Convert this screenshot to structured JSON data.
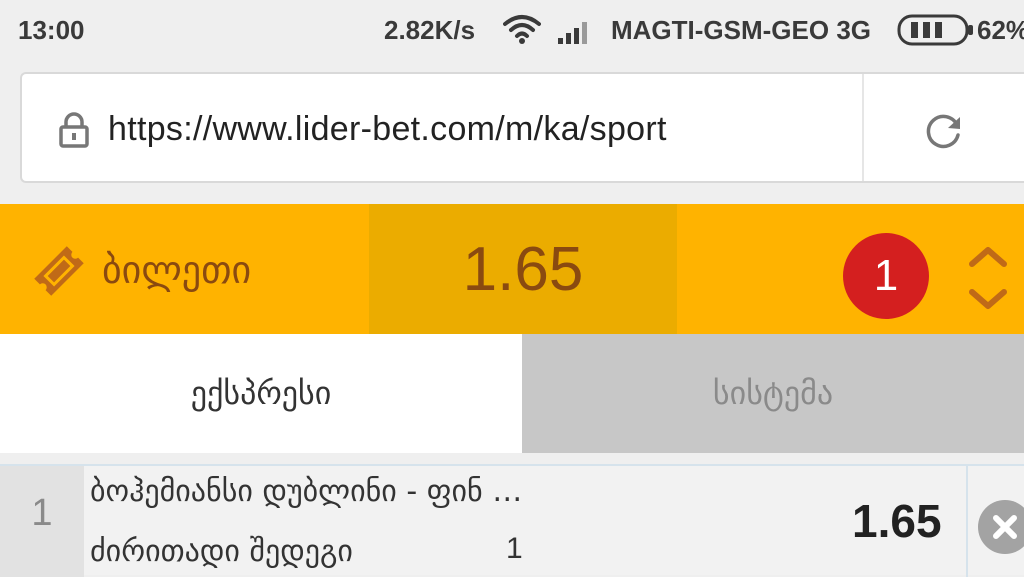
{
  "status_bar": {
    "time": "13:00",
    "speed": "2.82K/s",
    "carrier": "MAGTI-GSM-GEO 3G",
    "battery": "62%",
    "icons": [
      "wifi-icon",
      "signal-icon",
      "battery-icon"
    ]
  },
  "browser": {
    "url": "https://www.lider-bet.com/m/ka/sport",
    "icons": [
      "lock-icon",
      "reload-icon"
    ]
  },
  "ticket": {
    "label": "ბილეთი",
    "total_odds": "1.65",
    "count": "1",
    "icons": [
      "ticket-icon",
      "expand-collapse-icon"
    ]
  },
  "tabs": [
    {
      "label": "ექსპრესი",
      "active": true
    },
    {
      "label": "სისტემა",
      "active": false
    }
  ],
  "bets": [
    {
      "number": "1",
      "event": "ბოჰემიანსი დუბლინი - ფინ …",
      "market": "ძირითადი შედეგი",
      "outcome": "1",
      "odds": "1.65"
    }
  ],
  "colors": {
    "ticket_bar": "#ffb300",
    "ticket_odds_bg": "#ebac00",
    "ticket_text": "#8a4a10",
    "badge": "#d41f1f",
    "inactive_tab": "#c7c7c7"
  }
}
